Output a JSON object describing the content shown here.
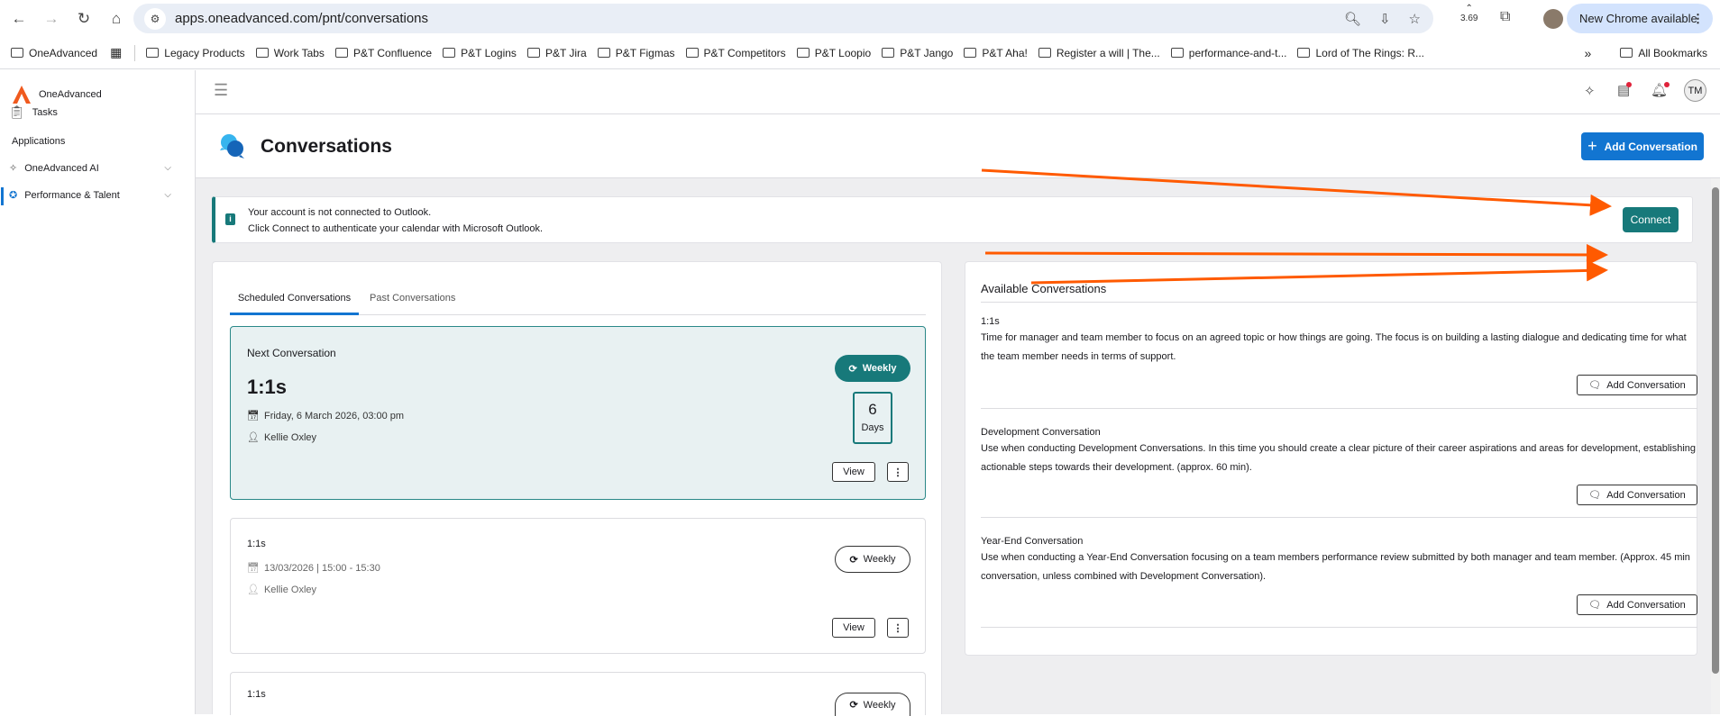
{
  "browser": {
    "url": "apps.oneadvanced.com/pnt/conversations",
    "extension_badge": "3.69",
    "new_chrome": "New Chrome available",
    "bookmarks": [
      "OneAdvanced",
      "Legacy Products",
      "Work Tabs",
      "P&T Confluence",
      "P&T Logins",
      "P&T Jira",
      "P&T Figmas",
      "P&T Competitors",
      "P&T Loopio",
      "P&T Jango",
      "P&T Aha!",
      "Register a will | The...",
      "performance-and-t...",
      "Lord of The Rings: R..."
    ],
    "more": "»",
    "all_bookmarks": "All Bookmarks"
  },
  "sidebar": {
    "brand": "OneAdvanced",
    "tasks": "Tasks",
    "section": "Applications",
    "items": [
      {
        "label": "OneAdvanced AI"
      },
      {
        "label": "Performance & Talent"
      }
    ]
  },
  "header": {
    "avatar": "TM"
  },
  "page": {
    "title": "Conversations",
    "add_button": "Add Conversation"
  },
  "banner": {
    "line1": "Your account is not connected to Outlook.",
    "line2": "Click Connect to authenticate your calendar with Microsoft Outlook.",
    "connect": "Connect"
  },
  "tabs": [
    "Scheduled Conversations",
    "Past Conversations"
  ],
  "next": {
    "label": "Next Conversation",
    "title": "1:1s",
    "date": "Friday, 6 March 2026, 03:00 pm",
    "person": "Kellie Oxley",
    "frequency": "Weekly",
    "days_num": "6",
    "days_label": "Days",
    "view": "View"
  },
  "scheduled": [
    {
      "title": "1:1s",
      "date": "13/03/2026 | 15:00 - 15:30",
      "person": "Kellie Oxley",
      "frequency": "Weekly",
      "view": "View"
    },
    {
      "title": "1:1s",
      "frequency": "Weekly"
    }
  ],
  "available": {
    "heading": "Available Conversations",
    "items": [
      {
        "title": "1:1s",
        "desc": "Time for manager and team member to focus on an agreed topic or how things are going. The focus is on building a lasting dialogue and dedicating time for what the team member needs in terms of support.",
        "button": "Add Conversation"
      },
      {
        "title": "Development Conversation",
        "desc": "Use when conducting Development Conversations. In this time you should create a clear picture of their career aspirations and areas for development, establishing actionable steps towards their development. (approx. 60 min).",
        "button": "Add Conversation"
      },
      {
        "title": "Year-End Conversation",
        "desc": "Use when conducting a Year-End Conversation focusing on a team members performance review submitted by both manager and team member. (Approx. 45 min conversation, unless combined with Development Conversation).",
        "button": "Add Conversation"
      }
    ]
  },
  "colors": {
    "teal": "#17797a",
    "blue": "#1275d1",
    "arrow": "#ff5a00"
  }
}
